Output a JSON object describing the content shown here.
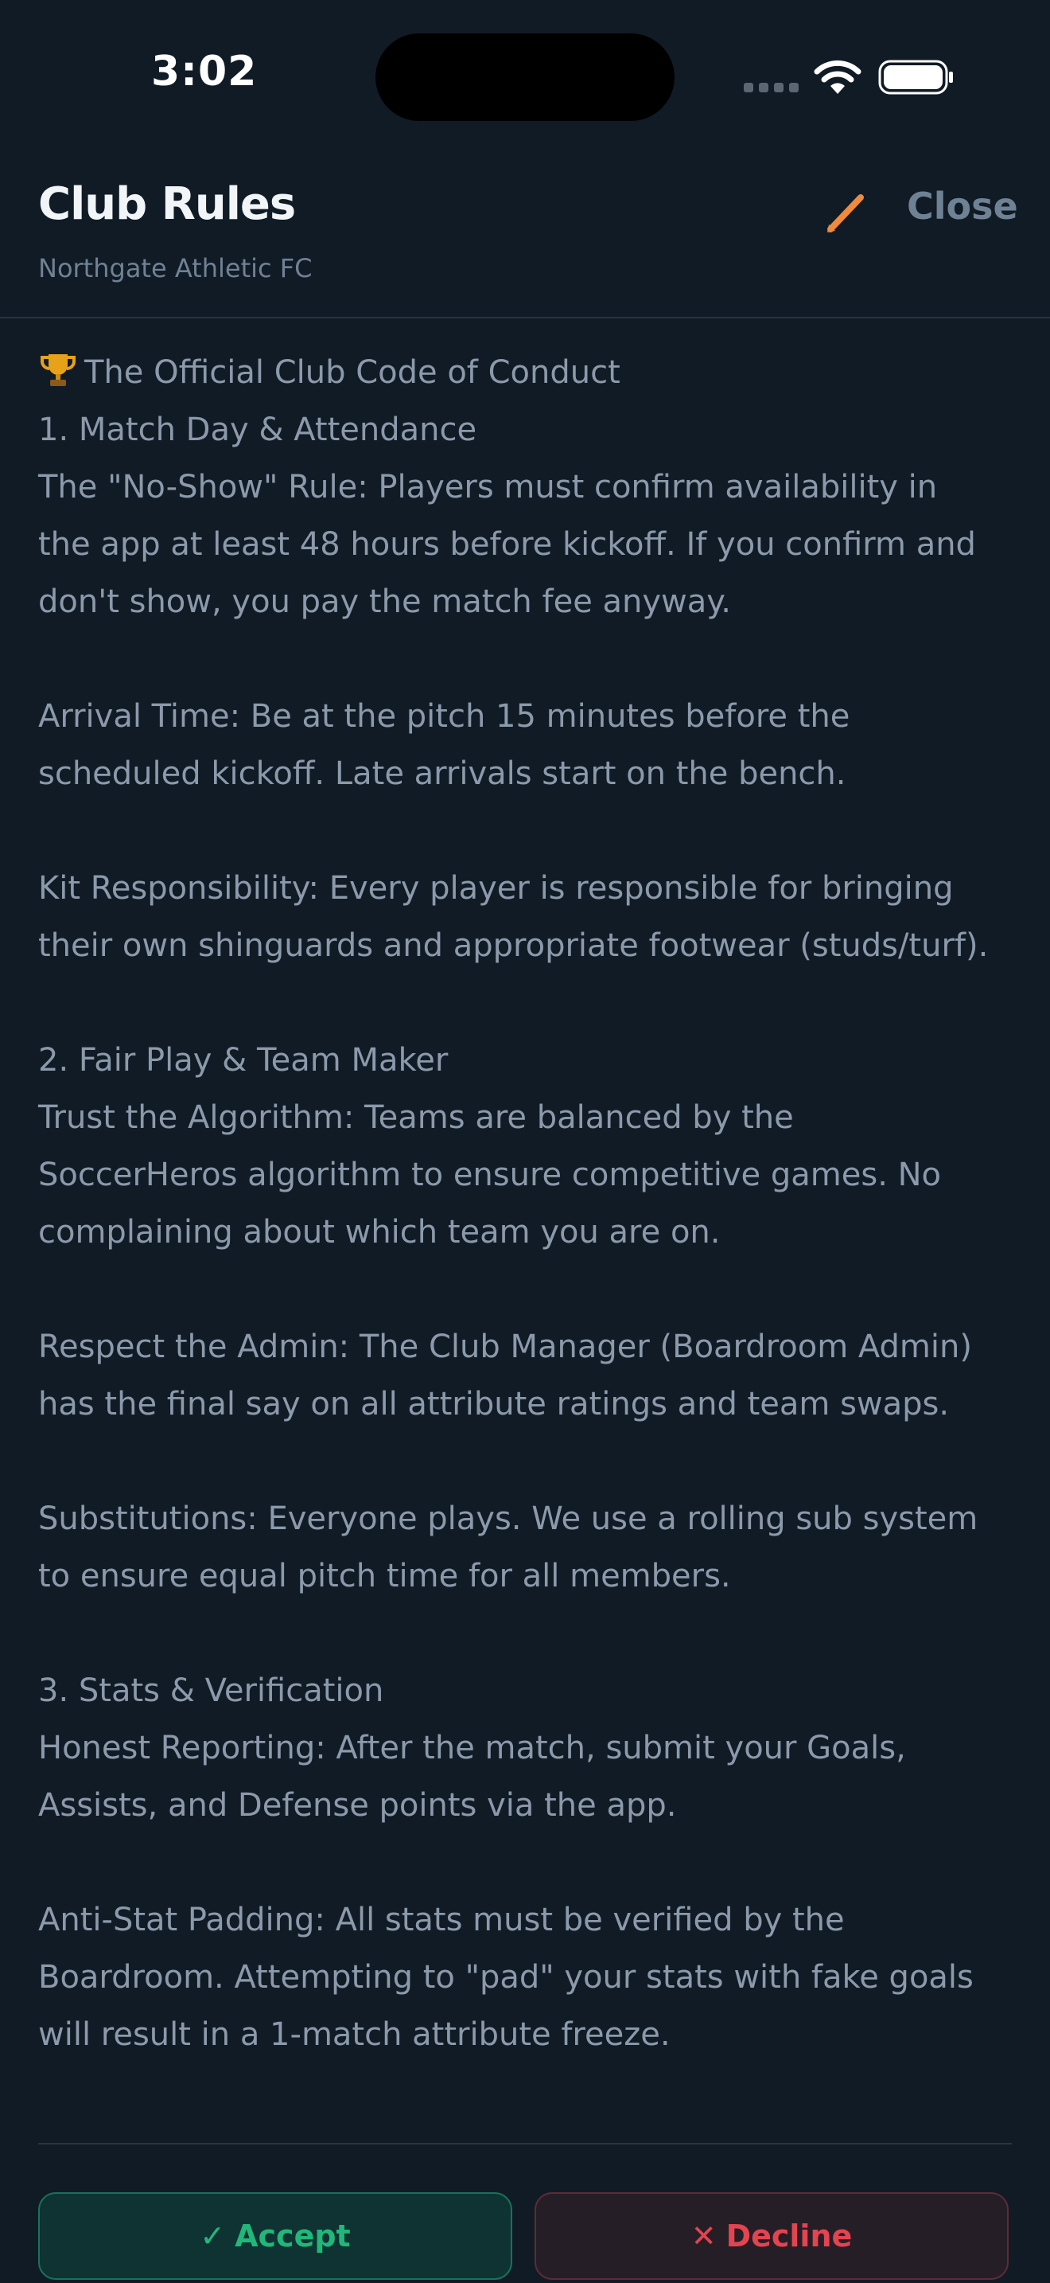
{
  "status_bar": {
    "time": "3:02"
  },
  "header": {
    "title": "Club Rules",
    "subtitle": "Northgate Athletic FC",
    "close_label": "Close"
  },
  "rules": {
    "heading": "The Official Club Code of Conduct",
    "heading_icon": "trophy-icon",
    "lines": [
      "1. Match Day & Attendance",
      "The \"No-Show\" Rule: Players must confirm availability in",
      "the app at least 48 hours before kickoff. If you confirm and",
      "don't show, you pay the match fee anyway.",
      "",
      "Arrival Time: Be at the pitch 15 minutes before the",
      "scheduled kickoff. Late arrivals start on the bench.",
      "",
      "Kit Responsibility: Every player is responsible for bringing",
      "their own shinguards and appropriate footwear (studs/turf).",
      "",
      "2. Fair Play & Team Maker",
      "Trust the Algorithm: Teams are balanced by the",
      "SoccerHeros algorithm to ensure competitive games. No",
      "complaining about which team you are on.",
      "",
      "Respect the Admin: The Club Manager (Boardroom Admin)",
      "has the final say on all attribute ratings and team swaps.",
      "",
      "Substitutions: Everyone plays. We use a rolling sub system",
      "to ensure equal pitch time for all members.",
      "",
      "3. Stats & Verification",
      "Honest Reporting: After the match, submit your Goals,",
      "Assists, and Defense points via the app.",
      "",
      "Anti-Stat Padding: All stats must be verified by the",
      "Boardroom. Attempting to \"pad\" your stats with fake goals",
      "will result in a 1-match attribute freeze."
    ]
  },
  "actions": {
    "accept_label": "Accept",
    "accept_icon": "check-icon",
    "decline_label": "Decline",
    "decline_icon": "x-icon"
  },
  "colors": {
    "background": "#111b26",
    "accent_edit": "#f08a3c",
    "accept": "#22b77a",
    "decline": "#e3444f"
  }
}
